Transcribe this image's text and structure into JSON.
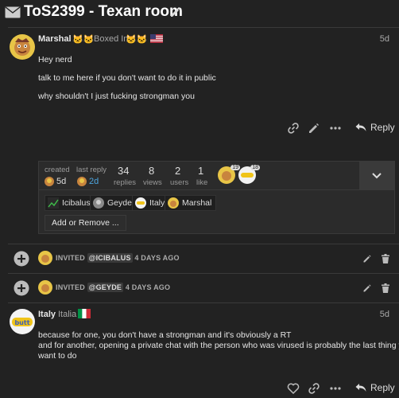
{
  "topic": {
    "title": "ToS2399 - Texan room"
  },
  "post1": {
    "username": "Marshal",
    "title_emoji": "🐱🐱",
    "user_title": "Boxed In",
    "date": "5d",
    "lines": [
      "Hey nerd",
      "talk to me here if you don't want to do it in public",
      "why shouldn't I just fucking strongman you"
    ],
    "reply_label": "Reply"
  },
  "topic_map": {
    "created_label": "created",
    "created_value": "5d",
    "last_reply_label": "last reply",
    "last_reply_value": "2d",
    "replies_num": "34",
    "replies_label": "replies",
    "views_num": "8",
    "views_label": "views",
    "users_num": "2",
    "users_label": "users",
    "likes_num": "1",
    "likes_label": "like",
    "poster_counts": [
      "19",
      "18"
    ],
    "allowed_users": [
      "Icibalus",
      "Geyde",
      "Italy",
      "Marshal"
    ],
    "add_remove_label": "Add or Remove ..."
  },
  "small_actions": [
    {
      "verb": "INVITED",
      "mention": "@ICIBALUS",
      "when": "4 DAYS AGO"
    },
    {
      "verb": "INVITED",
      "mention": "@GEYDE",
      "when": "4 DAYS AGO"
    }
  ],
  "post2": {
    "username": "Italy",
    "user_title": "Italia",
    "date": "5d",
    "lines": [
      "because for one, you don't have a strongman and it's obviously a RT",
      "and for another, opening a private chat with the person who was virused is probably the last thing you",
      "want to do"
    ],
    "reply_label": "Reply"
  },
  "colors": {
    "background": "#222222",
    "text": "#dddddd",
    "muted": "#a8a8a8",
    "link": "#4da6e0"
  }
}
